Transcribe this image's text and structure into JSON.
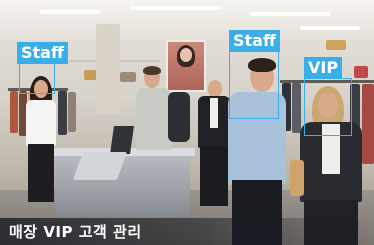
{
  "labels": {
    "staff_left": "Staff",
    "staff_center": "Staff",
    "vip": "VIP"
  },
  "caption": "매장 VIP 고객 관리",
  "colors": {
    "accent": "#3aaee8",
    "caption_bg": "#141820"
  }
}
